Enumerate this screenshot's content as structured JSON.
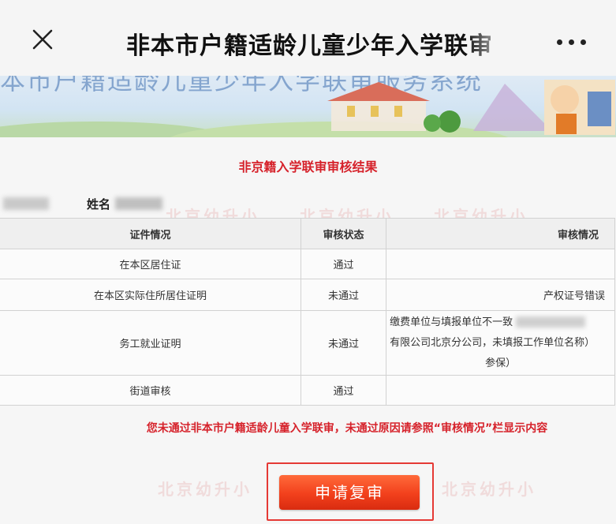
{
  "nav": {
    "title": "非本市户籍适龄儿童少年入学联审"
  },
  "banner": {
    "title": "本市户籍适龄儿童少年入学联审服务系统"
  },
  "page": {
    "result_title": "非京籍入学联审审核结果",
    "name_label": "姓名",
    "table": {
      "headers": [
        "证件情况",
        "审核状态",
        "审核情况"
      ],
      "rows": [
        {
          "document": "在本区居住证",
          "status": "通过",
          "note": ""
        },
        {
          "document": "在本区实际住所居住证明",
          "status": "未通过",
          "note": "产权证号错误"
        },
        {
          "document": "务工就业证明",
          "status": "未通过",
          "note_lines": [
            "缴费单位与填报单位不一致",
            "有限公司北京分公司，未填报工作单位名称）",
            "参保）"
          ]
        },
        {
          "document": "街道审核",
          "status": "通过",
          "note": ""
        }
      ]
    },
    "warning": "您未通过非本市户籍适龄儿童入学联审，未通过原因请参照“审核情况”栏显示内容",
    "review_button": "申请复审",
    "watermark": "北京幼升小"
  },
  "colors": {
    "accent_red": "#d6222b",
    "pass_green": "#2aa13b",
    "fail_red": "#e0302f",
    "button_orange": "#f2401c"
  },
  "icons": {
    "close": "close-icon",
    "more": "more-dots-icon"
  }
}
